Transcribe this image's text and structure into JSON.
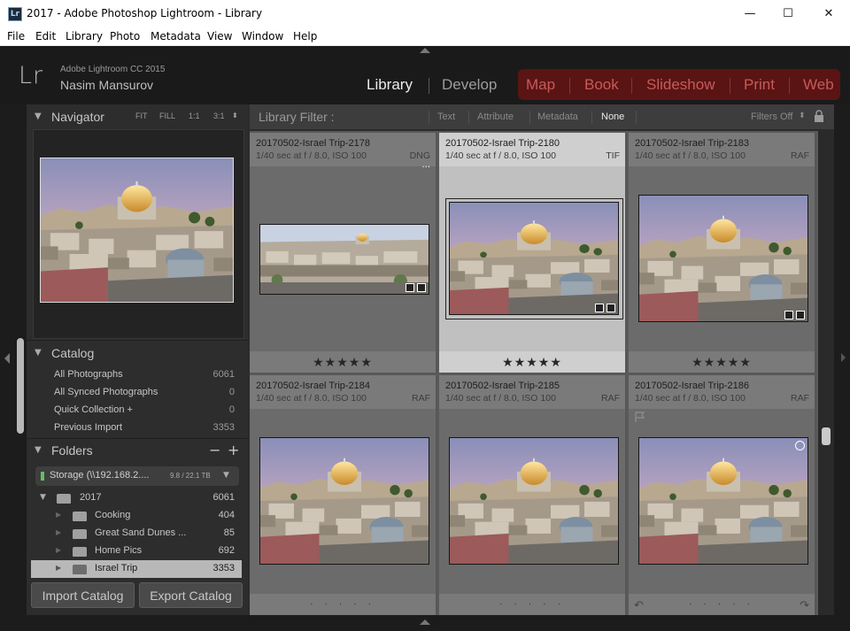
{
  "window": {
    "title": "2017 - Adobe Photoshop Lightroom - Library",
    "app_icon": "Lr",
    "minimize": "—",
    "maximize": "☐",
    "close": "✕"
  },
  "menu": [
    "File",
    "Edit",
    "Library",
    "Photo",
    "Metadata",
    "View",
    "Window",
    "Help"
  ],
  "identity": {
    "logo": "Lr",
    "app_name": "Adobe Lightroom CC 2015",
    "user_name": "Nasim Mansurov"
  },
  "modules": [
    {
      "label": "Library",
      "active": true
    },
    {
      "label": "Develop",
      "active": false
    },
    {
      "label": "Map",
      "active": false
    },
    {
      "label": "Book",
      "active": false
    },
    {
      "label": "Slideshow",
      "active": false
    },
    {
      "label": "Print",
      "active": false
    },
    {
      "label": "Web",
      "active": false
    }
  ],
  "navigator": {
    "title": "Navigator",
    "zoom_options": [
      "FIT",
      "FILL",
      "1:1",
      "3:1"
    ]
  },
  "catalog": {
    "title": "Catalog",
    "items": [
      {
        "label": "All Photographs",
        "count": "6061"
      },
      {
        "label": "All Synced Photographs",
        "count": "0"
      },
      {
        "label": "Quick Collection  +",
        "count": "0"
      },
      {
        "label": "Previous Import",
        "count": "3353"
      }
    ]
  },
  "folders": {
    "title": "Folders",
    "minus": "−",
    "plus": "+",
    "storage": {
      "label": "Storage  (\\\\192.168.2....",
      "capacity": "9.8 / 22.1 TB"
    },
    "items": [
      {
        "label": "2017",
        "count": "6061",
        "level": 0,
        "selected": false
      },
      {
        "label": "Cooking",
        "count": "404",
        "level": 1,
        "selected": false
      },
      {
        "label": "Great Sand Dunes ...",
        "count": "85",
        "level": 1,
        "selected": false
      },
      {
        "label": "Home Pics",
        "count": "692",
        "level": 1,
        "selected": false
      },
      {
        "label": "Israel Trip",
        "count": "3353",
        "level": 1,
        "selected": true
      }
    ]
  },
  "buttons": {
    "import_catalog": "Import Catalog",
    "export_catalog": "Export Catalog"
  },
  "filter_bar": {
    "title": "Library Filter :",
    "options": [
      "Text",
      "Attribute",
      "Metadata",
      "None"
    ],
    "active": "None",
    "filters_off": "Filters Off",
    "lock_icon": "lock-icon"
  },
  "grid": [
    {
      "name": "20170502-Israel Trip-2178",
      "exif": "1/40 sec at f / 8.0, ISO 100",
      "ext": "DNG",
      "rating": "★★★★★",
      "selected": false,
      "panorama": true,
      "more": "···"
    },
    {
      "name": "20170502-Israel Trip-2180",
      "exif": "1/40 sec at f / 8.0, ISO 100",
      "ext": "TIF",
      "rating": "★★★★★",
      "selected": true,
      "panorama": false
    },
    {
      "name": "20170502-Israel Trip-2183",
      "exif": "1/40 sec at f / 8.0, ISO 100",
      "ext": "RAF",
      "rating": "★★★★★",
      "selected": false,
      "panorama": false
    },
    {
      "name": "20170502-Israel Trip-2184",
      "exif": "1/40 sec at f / 8.0, ISO 100",
      "ext": "RAF",
      "rating": "· · · · ·",
      "selected": false,
      "panorama": false
    },
    {
      "name": "20170502-Israel Trip-2185",
      "exif": "1/40 sec at f / 8.0, ISO 100",
      "ext": "RAF",
      "rating": "· · · · ·",
      "selected": false,
      "panorama": false
    },
    {
      "name": "20170502-Israel Trip-2186",
      "exif": "1/40 sec at f / 8.0, ISO 100",
      "ext": "RAF",
      "rating": "· · · · ·",
      "selected": false,
      "panorama": false
    }
  ],
  "colors": {
    "module_active": "#ececec",
    "module_inactive": "#9c9c9c",
    "module_web": "#c85a5a",
    "web_group_bg": "#5a1414"
  }
}
